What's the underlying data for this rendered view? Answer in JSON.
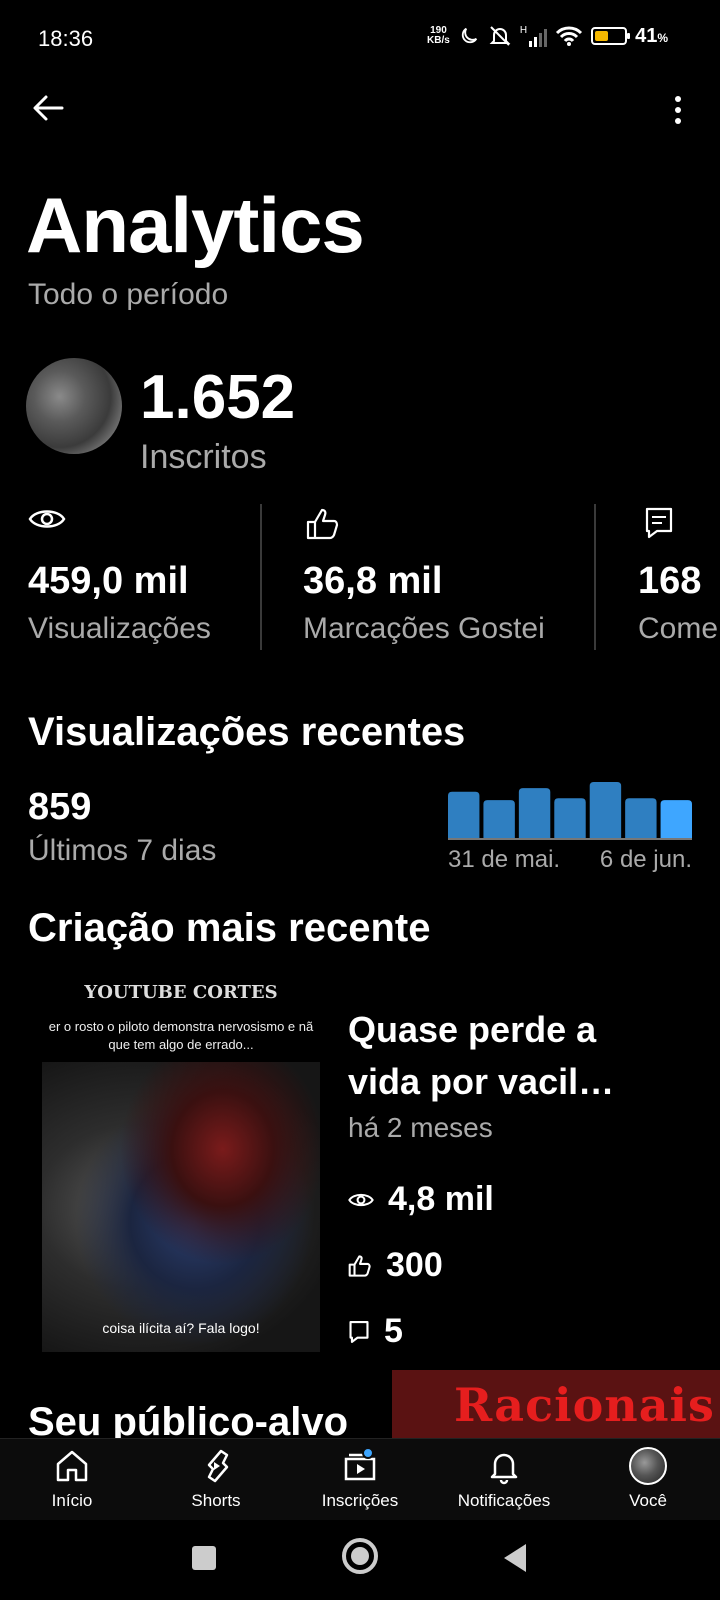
{
  "status_bar": {
    "time": "18:36",
    "net_speed_value": "190",
    "net_speed_unit": "KB/s",
    "network_type": "H",
    "battery": "41",
    "battery_unit": "%"
  },
  "header": {
    "back_icon": "arrow-left-icon",
    "more_icon": "more-vertical-icon"
  },
  "page": {
    "title": "Analytics",
    "period": "Todo o período"
  },
  "channel": {
    "subscribers": "1.652",
    "subscribers_label": "Inscritos"
  },
  "metrics": [
    {
      "icon": "eye-icon",
      "value": "459,0 mil",
      "label": "Visualizações"
    },
    {
      "icon": "thumbs-up-icon",
      "value": "36,8 mil",
      "label": "Marcações Gostei"
    },
    {
      "icon": "comment-icon",
      "value": "168",
      "label": "Comentários"
    }
  ],
  "recent_views": {
    "title": "Visualizações recentes",
    "count": "859",
    "period_label": "Últimos 7 dias",
    "start_label": "31 de mai.",
    "end_label": "6 de jun."
  },
  "chart_data": {
    "type": "bar",
    "categories": [
      "31 de mai.",
      "",
      "",
      "",
      "",
      "",
      "6 de jun."
    ],
    "values": [
      128,
      105,
      138,
      110,
      155,
      110,
      105
    ],
    "highlight_last": true,
    "colors": {
      "bar": "#2f7fc1",
      "bar_last": "#3ea6ff"
    }
  },
  "latest_content": {
    "title": "Criação mais recente",
    "video_title": "Quase perde a vida por vacil…",
    "age": "há 2 meses",
    "views": "4,8 mil",
    "likes": "300",
    "comments": "5",
    "thumbnail": {
      "top_text": "YOUTUBE CORTES",
      "caption_top": "er o rosto o piloto demonstra nervosismo e nã que tem algo de errado...",
      "caption_bottom": "coisa ilícita aí? Fala logo!"
    }
  },
  "audience": {
    "title": "Seu público-alvo"
  },
  "banner": {
    "text": "Racionais"
  },
  "bottom_nav": [
    {
      "label": "Início",
      "icon": "home-icon"
    },
    {
      "label": "Shorts",
      "icon": "shorts-icon"
    },
    {
      "label": "Inscrições",
      "icon": "subscriptions-icon"
    },
    {
      "label": "Notificações",
      "icon": "bell-icon"
    },
    {
      "label": "Você",
      "icon": "avatar"
    }
  ],
  "colors": {
    "background": "#000000",
    "secondary_text": "#aaaaaa",
    "accent": "#3ea6ff"
  }
}
